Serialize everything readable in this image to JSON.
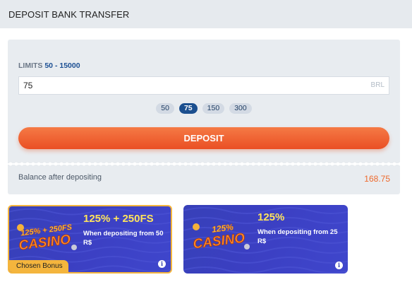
{
  "header": {
    "title": "DEPOSIT BANK TRANSFER"
  },
  "form": {
    "limits_label": "LIMITS",
    "limits_value": "50 - 15000",
    "amount_value": "75",
    "currency": "BRL",
    "presets": [
      "50",
      "75",
      "150",
      "300"
    ],
    "active_preset": "75",
    "deposit_label": "DEPOSIT",
    "balance_label": "Balance after depositing",
    "balance_value": "168.75"
  },
  "bonuses": [
    {
      "title": "125% + 250FS",
      "logo_line1": "125% + 250FS",
      "logo_line2": "CASINO",
      "description": "When depositing from 50 R$",
      "selected": true,
      "badge": "Chosen Bonus"
    },
    {
      "title": "125%",
      "logo_line1": "125%",
      "logo_line2": "CASINO",
      "description": "When depositing from 25 R$",
      "selected": false
    }
  ],
  "colors": {
    "accent_orange": "#ea4f24",
    "brand_blue": "#1b4f8f",
    "bonus_bg": "#3b3fc2",
    "bonus_title": "#ffe45c",
    "chosen_badge": "#f4b53d"
  }
}
